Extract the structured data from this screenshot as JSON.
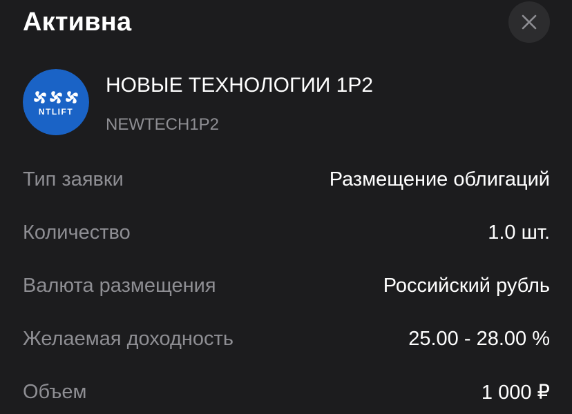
{
  "header": {
    "status": "Активна",
    "close_icon": "close-icon"
  },
  "instrument": {
    "logo_text": "NTLIFT",
    "logo_color": "#1a63c6",
    "name": "НОВЫЕ ТЕХНОЛОГИИ 1Р2",
    "ticker": "NEWTECH1P2"
  },
  "details": [
    {
      "label": "Тип заявки",
      "value": "Размещение облигаций"
    },
    {
      "label": "Количество",
      "value": "1.0 шт."
    },
    {
      "label": "Валюта размещения",
      "value": "Российский рубль"
    },
    {
      "label": "Желаемая доходность",
      "value": "25.00 - 28.00 %"
    },
    {
      "label": "Объем",
      "value": "1 000 ₽"
    }
  ],
  "colors": {
    "background": "#1c1c1e",
    "secondary_text": "#8e8e93",
    "primary_text": "#ffffff"
  }
}
